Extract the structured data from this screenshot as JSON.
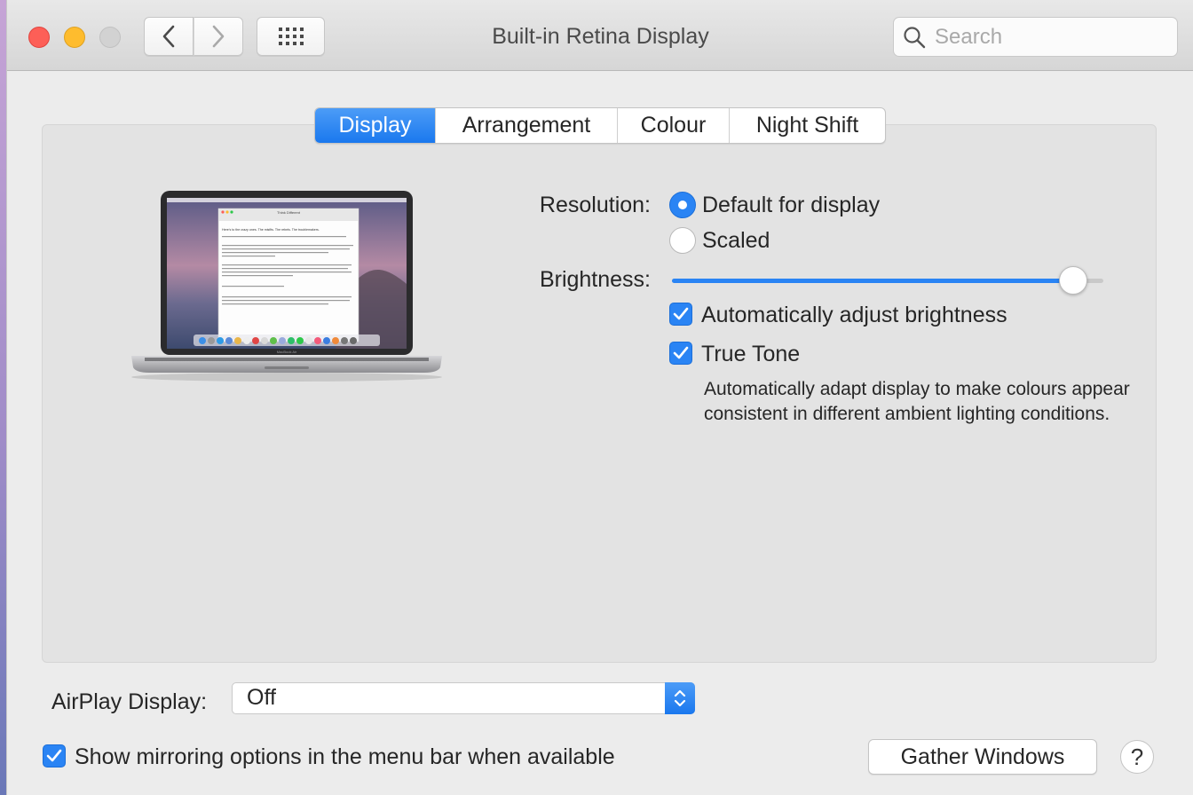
{
  "window": {
    "title": "Built-in Retina Display"
  },
  "toolbar": {
    "search_placeholder": "Search"
  },
  "tabs": [
    {
      "label": "Display",
      "active": true
    },
    {
      "label": "Arrangement",
      "active": false
    },
    {
      "label": "Colour",
      "active": false
    },
    {
      "label": "Night Shift",
      "active": false
    }
  ],
  "display": {
    "resolution_label": "Resolution:",
    "resolution_options": [
      {
        "label": "Default for display",
        "selected": true
      },
      {
        "label": "Scaled",
        "selected": false
      }
    ],
    "brightness_label": "Brightness:",
    "brightness_level": 0.93,
    "auto_brightness_label": "Automatically adjust brightness",
    "auto_brightness_checked": true,
    "true_tone_label": "True Tone",
    "true_tone_checked": true,
    "true_tone_description": "Automatically adapt display to make colours appear consistent in different ambient lighting conditions.",
    "laptop_screen_window_title": "Think Different",
    "laptop_screen_text": "Here's to the crazy ones. The misfits. The rebels. The troublemakers.",
    "laptop_brand": "MacBook Air"
  },
  "footer": {
    "airplay_label": "AirPlay Display:",
    "airplay_value": "Off",
    "mirroring_label": "Show mirroring options in the menu bar when available",
    "mirroring_checked": true,
    "gather_windows_label": "Gather Windows",
    "help_label": "?"
  },
  "colors": {
    "accent": "#2a84f4",
    "window_bg": "#ececec",
    "panel_bg": "#e3e3e3"
  }
}
